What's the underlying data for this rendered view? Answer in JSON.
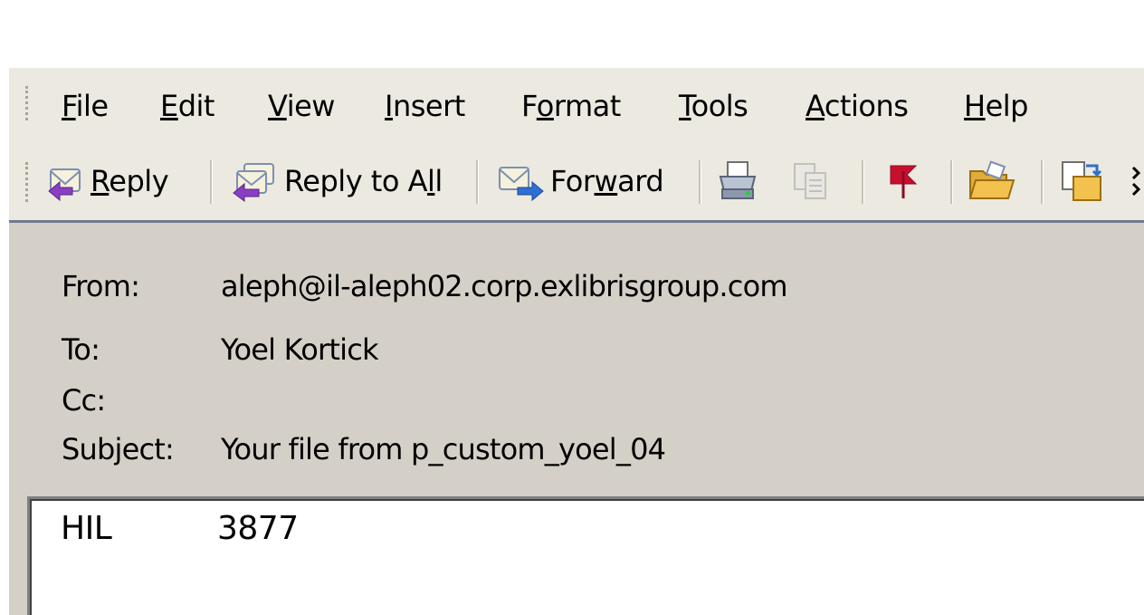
{
  "menu": {
    "items": [
      {
        "accel": "F",
        "rest": "ile"
      },
      {
        "accel": "E",
        "rest": "dit"
      },
      {
        "accel": "V",
        "rest": "iew"
      },
      {
        "accel": "I",
        "rest": "nsert"
      },
      {
        "pre": "F",
        "accel": "o",
        "rest": "rmat"
      },
      {
        "accel": "T",
        "rest": "ools"
      },
      {
        "accel": "A",
        "rest": "ctions"
      },
      {
        "accel": "H",
        "rest": "elp"
      }
    ]
  },
  "toolbar": {
    "reply": {
      "accel": "R",
      "rest": "eply"
    },
    "reply_all": {
      "pre": "Reply to A",
      "accel": "l",
      "rest": "l"
    },
    "forward": {
      "pre": "For",
      "accel": "w",
      "rest": "ard"
    },
    "icons": [
      "reply-icon",
      "reply-all-icon",
      "forward-icon",
      "print-icon",
      "copy-icon",
      "flag-icon",
      "open-folder-icon",
      "move-icon"
    ],
    "colors": {
      "flag": "#c8102e",
      "folder": "#f2c14e"
    }
  },
  "header": {
    "from_label": "From:",
    "from_value": "aleph@il-aleph02.corp.exlibrisgroup.com",
    "to_label": "To:",
    "to_value": "Yoel Kortick",
    "cc_label": "Cc:",
    "cc_value": "",
    "subject_label": "Subject:",
    "subject_value": "Your file from p_custom_yoel_04"
  },
  "body": {
    "col1": "HIL",
    "col2": "3877"
  }
}
